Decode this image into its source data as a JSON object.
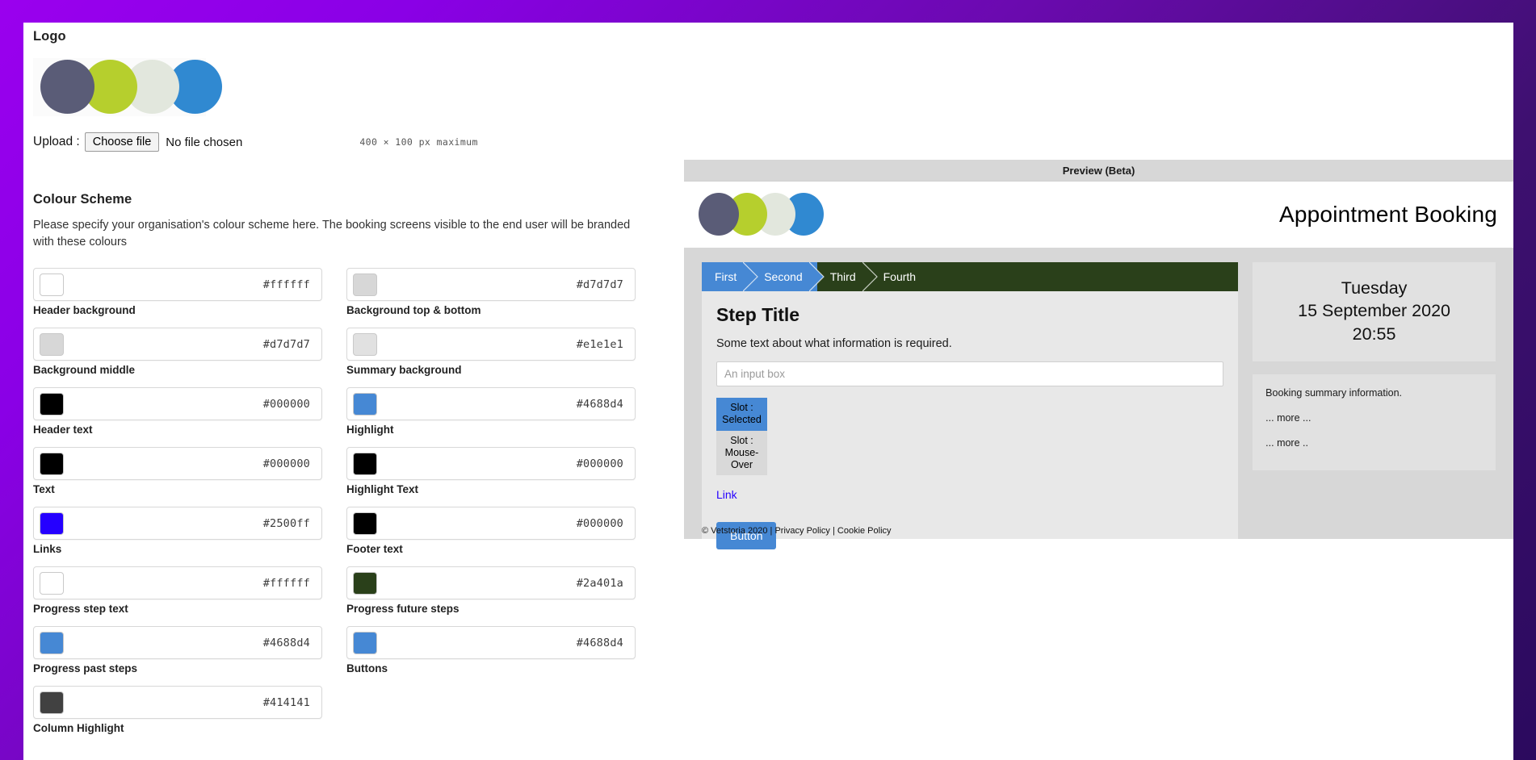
{
  "logo": {
    "section_title": "Logo",
    "upload_label": "Upload :",
    "choose_file_label": "Choose file",
    "no_file_text": "No file chosen",
    "max_size_text": "400 × 100 px maximum",
    "dots": [
      "#5a5c77",
      "#b6cf2d",
      "#e2e7dd",
      "#3089d1"
    ]
  },
  "colour_scheme": {
    "section_title": "Colour Scheme",
    "description": "Please specify your organisation's colour scheme here. The booking screens visible to the end user will be branded with these colours",
    "fields": [
      {
        "label": "Header background",
        "hex": "#ffffff",
        "swatch": "#ffffff"
      },
      {
        "label": "Background top & bottom",
        "hex": "#d7d7d7",
        "swatch": "#d7d7d7"
      },
      {
        "label": "Background middle",
        "hex": "#d7d7d7",
        "swatch": "#d7d7d7"
      },
      {
        "label": "Summary background",
        "hex": "#e1e1e1",
        "swatch": "#e1e1e1"
      },
      {
        "label": "Header text",
        "hex": "#000000",
        "swatch": "#000000"
      },
      {
        "label": "Highlight",
        "hex": "#4688d4",
        "swatch": "#4688d4"
      },
      {
        "label": "Text",
        "hex": "#000000",
        "swatch": "#000000"
      },
      {
        "label": "Highlight Text",
        "hex": "#000000",
        "swatch": "#000000"
      },
      {
        "label": "Links",
        "hex": "#2500ff",
        "swatch": "#2500ff"
      },
      {
        "label": "Footer text",
        "hex": "#000000",
        "swatch": "#000000"
      },
      {
        "label": "Progress step text",
        "hex": "#ffffff",
        "swatch": "#ffffff"
      },
      {
        "label": "Progress future steps",
        "hex": "#2a401a",
        "swatch": "#2a401a"
      },
      {
        "label": "Progress past steps",
        "hex": "#4688d4",
        "swatch": "#4688d4"
      },
      {
        "label": "Buttons",
        "hex": "#4688d4",
        "swatch": "#4688d4"
      },
      {
        "label": "Column Highlight",
        "hex": "#414141",
        "swatch": "#414141"
      }
    ]
  },
  "preview": {
    "bar_title": "Preview (Beta)",
    "app_title": "Appointment Booking",
    "steps": [
      {
        "label": "First",
        "state": "past"
      },
      {
        "label": "Second",
        "state": "past"
      },
      {
        "label": "Third",
        "state": "future"
      },
      {
        "label": "Fourth",
        "state": "future"
      }
    ],
    "step_title": "Step Title",
    "step_description": "Some text about what information is required.",
    "input_placeholder": "An input box",
    "input_value": "",
    "slot_selected_label": "Slot : Selected",
    "slot_hover_label": "Slot : Mouse-Over",
    "link_label": "Link",
    "button_label": "Button",
    "date_line1": "Tuesday",
    "date_line2": "15 September 2020",
    "date_line3": "20:55",
    "summary_lines": [
      "Booking summary information.",
      "... more ...",
      "... more .."
    ],
    "footer_text": "© Vetstoria 2020 | Privacy Policy | Cookie Policy"
  }
}
